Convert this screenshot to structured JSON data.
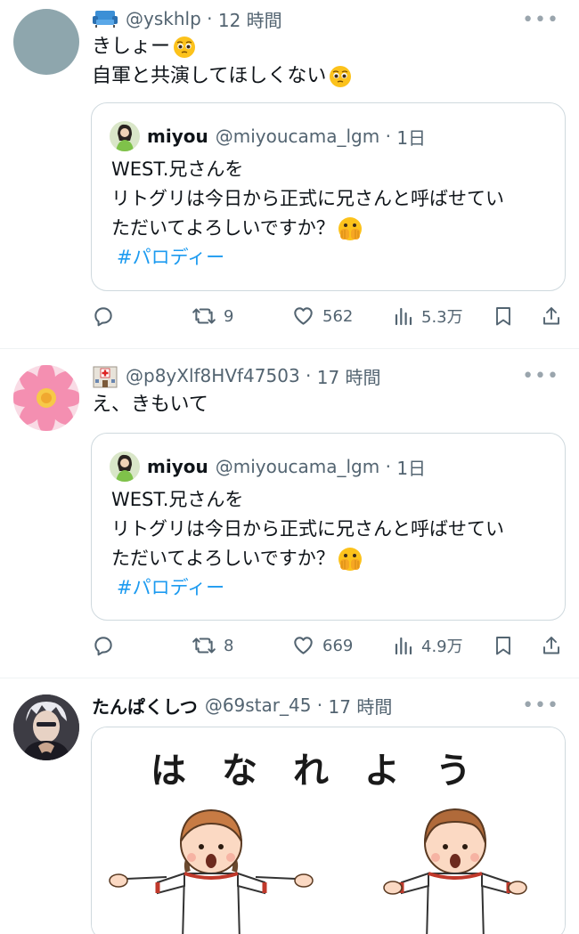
{
  "tweets": [
    {
      "handle": "@yskhlp",
      "time": "12 時間",
      "lines": [
        "きしょー",
        "自軍と共演してほしくない"
      ],
      "quote": {
        "name": "miyou",
        "handle": "@miyoucama_lgm",
        "time": "1日",
        "lines": [
          "WEST.兄さんを",
          "リトグリは今日から正式に兄さんと呼ばせてい",
          "ただいてよろしいですか？"
        ],
        "hashtag": "#パロディー"
      },
      "stats": {
        "retweets": "9",
        "likes": "562",
        "views": "5.3万"
      }
    },
    {
      "handle": "@p8yXlf8HVf47503",
      "time": "17 時間",
      "lines": [
        "え、きもいて"
      ],
      "quote": {
        "name": "miyou",
        "handle": "@miyoucama_lgm",
        "time": "1日",
        "lines": [
          "WEST.兄さんを",
          "リトグリは今日から正式に兄さんと呼ばせてい",
          "ただいてよろしいですか？"
        ],
        "hashtag": "#パロディー"
      },
      "stats": {
        "retweets": "8",
        "likes": "669",
        "views": "4.9万"
      }
    },
    {
      "name": "たんぱくしつ",
      "handle": "@69star_45",
      "time": "17 時間",
      "image_caption": "はなれよう"
    }
  ],
  "icons": {
    "more": "more-dots-icon",
    "reply": "reply-icon",
    "retweet": "retweet-icon",
    "like": "heart-icon",
    "views": "views-icon",
    "bookmark": "bookmark-icon",
    "share": "share-icon"
  },
  "colors": {
    "text": "#0f1419",
    "secondary": "#536471",
    "link": "#1d9bf0",
    "border": "#cfd9de"
  }
}
